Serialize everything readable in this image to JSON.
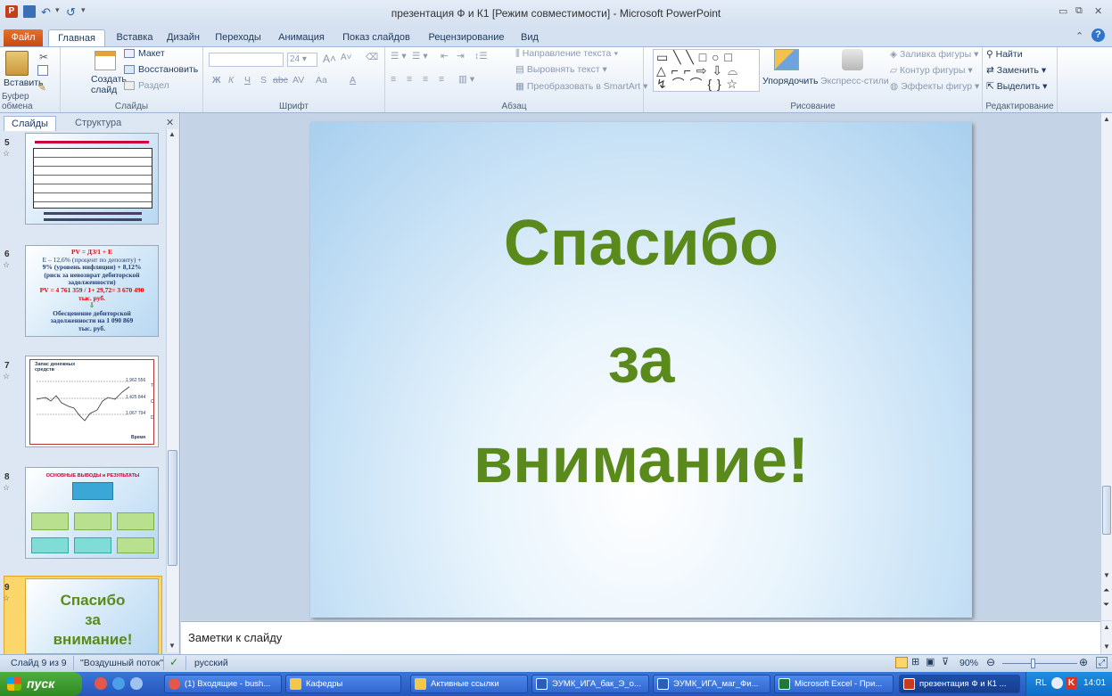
{
  "window": {
    "title": "презентация Ф и К1 [Режим совместимости]  -  Microsoft PowerPoint"
  },
  "colors": {
    "accent_green": "#5a8a1c",
    "file_tab": "#d65c1e",
    "taskbar": "#2557bd"
  },
  "tabs": [
    {
      "label": "Файл"
    },
    {
      "label": "Главная"
    },
    {
      "label": "Вставка"
    },
    {
      "label": "Дизайн"
    },
    {
      "label": "Переходы"
    },
    {
      "label": "Анимация"
    },
    {
      "label": "Показ слайдов"
    },
    {
      "label": "Рецензирование"
    },
    {
      "label": "Вид"
    }
  ],
  "ribbon": {
    "clipboard": {
      "paste": "Вставить",
      "label": "Буфер обмена"
    },
    "slides": {
      "new_slide": "Создать слайд",
      "layout": "Макет",
      "reset": "Восстановить",
      "section": "Раздел",
      "label": "Слайды"
    },
    "font": {
      "size": "24",
      "label": "Шрифт",
      "bold": "Ж",
      "italic": "К",
      "underline": "Ч",
      "strike": "S",
      "abc": "abc",
      "spacing": "AV",
      "case": "Aa",
      "color": "A"
    },
    "paragraph": {
      "direction": "Направление текста",
      "align": "Выровнять текст",
      "smartart": "Преобразовать в SmartArt",
      "label": "Абзац"
    },
    "drawing": {
      "arrange": "Упорядочить",
      "quick_styles": "Экспресс-стили",
      "fill": "Заливка фигуры",
      "outline": "Контур фигуры",
      "effects": "Эффекты фигур",
      "label": "Рисование"
    },
    "editing": {
      "find": "Найти",
      "replace": "Заменить",
      "select": "Выделить",
      "label": "Редактирование"
    }
  },
  "left_pane": {
    "tab_slides": "Слайды",
    "tab_outline": "Структура",
    "thumbnails": [
      {
        "number": "5"
      },
      {
        "number": "6",
        "lines": [
          "PV = ДЗ/1 + E",
          "E – 12,6% (процент по депозиту) +",
          "9% (уровень инфляции) + 8,12%",
          "(риск за невозврат дебиторской",
          "задолженности)",
          "PV = 4 761 359 / 1+ 29,72= 3 670 490",
          "тыс. руб.",
          "Обесценение дебиторской",
          "задолженности на 1 090 869",
          "тыс. руб."
        ]
      },
      {
        "number": "7",
        "lines": [
          "Запас денежных средств",
          "1 962 556",
          "1 425 844",
          "1 067 794",
          "T",
          "C",
          "D",
          "Время"
        ]
      },
      {
        "number": "8",
        "lines": [
          "ОСНОВНЫЕ ВЫВОДЫ и РЕЗУЛЬТАТЫ"
        ]
      },
      {
        "number": "9",
        "lines": [
          "Спасибо",
          "за",
          "внимание!"
        ]
      }
    ]
  },
  "slide": {
    "line1": "Спасибо",
    "line2": "за",
    "line3": "внимание!"
  },
  "notes": {
    "placeholder": "Заметки к слайду"
  },
  "status": {
    "slide": "Слайд 9 из 9",
    "theme": "\"Воздушный поток\"",
    "language": "русский",
    "zoom": "90%"
  },
  "taskbar": {
    "start": "пуск",
    "items": [
      {
        "label": "(1) Входящие - bush..."
      },
      {
        "label": "Кафедры"
      },
      {
        "label": "Активные ссылки"
      },
      {
        "label": "ЭУМК_ИГА_бак_Э_о..."
      },
      {
        "label": "ЭУМК_ИГА_маг_Фи..."
      },
      {
        "label": "Microsoft Excel - При..."
      },
      {
        "label": "презентация Ф и К1 ..."
      }
    ],
    "lang": "RL",
    "time": "14:01"
  }
}
